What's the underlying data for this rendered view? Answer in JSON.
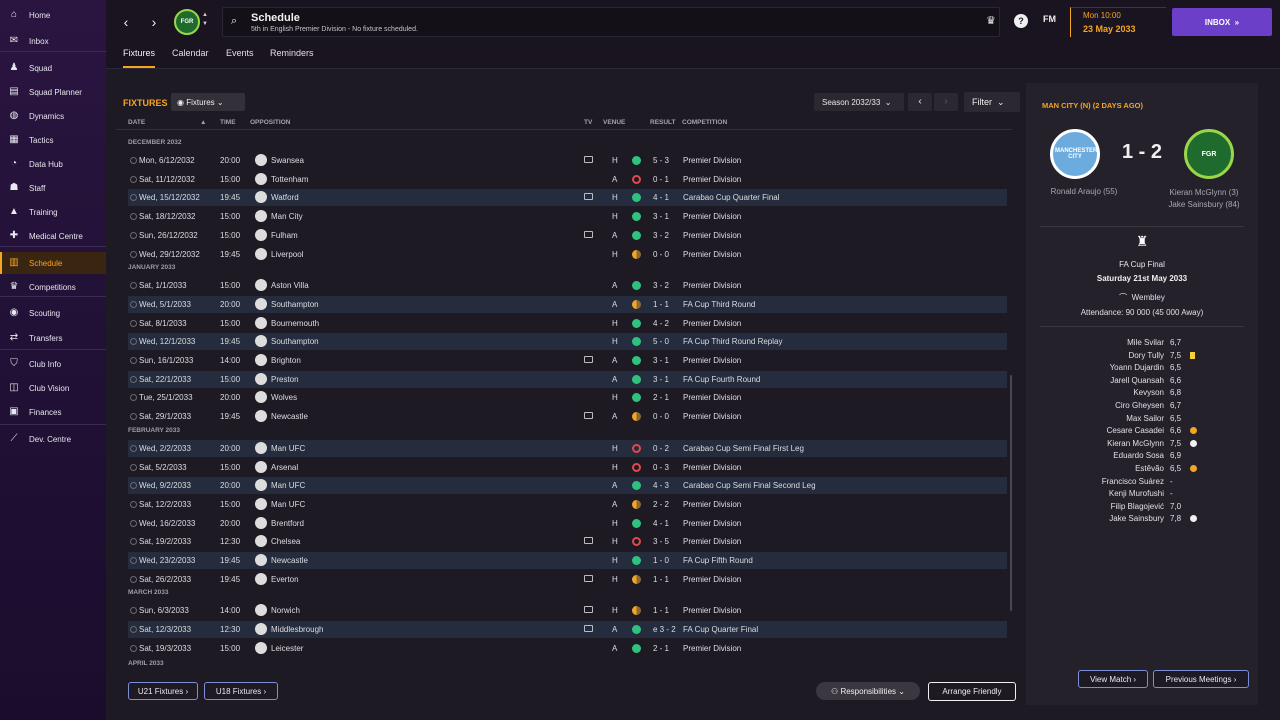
{
  "nav": [
    {
      "label": "Home",
      "icon": "home-icon",
      "glyph": "⌂"
    },
    {
      "label": "Inbox",
      "icon": "inbox-icon",
      "glyph": "✉"
    },
    {
      "label": "Squad",
      "icon": "shirt-icon",
      "glyph": "♟"
    },
    {
      "label": "Squad Planner",
      "icon": "planner-icon",
      "glyph": "▤"
    },
    {
      "label": "Dynamics",
      "icon": "dynamics-icon",
      "glyph": "◍"
    },
    {
      "label": "Tactics",
      "icon": "tactics-icon",
      "glyph": "▦"
    },
    {
      "label": "Data Hub",
      "icon": "data-hub-icon",
      "glyph": "◔"
    },
    {
      "label": "Staff",
      "icon": "staff-icon",
      "glyph": "☗"
    },
    {
      "label": "Training",
      "icon": "training-icon",
      "glyph": "▲"
    },
    {
      "label": "Medical Centre",
      "icon": "medical-icon",
      "glyph": "✚"
    },
    {
      "label": "Schedule",
      "icon": "calendar-icon",
      "glyph": "▥"
    },
    {
      "label": "Competitions",
      "icon": "trophy-icon",
      "glyph": "♛"
    },
    {
      "label": "Scouting",
      "icon": "scouting-icon",
      "glyph": "◉"
    },
    {
      "label": "Transfers",
      "icon": "transfers-icon",
      "glyph": "⇄"
    },
    {
      "label": "Club Info",
      "icon": "shield-icon",
      "glyph": "⛉"
    },
    {
      "label": "Club Vision",
      "icon": "vision-icon",
      "glyph": "◫"
    },
    {
      "label": "Finances",
      "icon": "finances-icon",
      "glyph": "▣"
    },
    {
      "label": "Dev. Centre",
      "icon": "dev-centre-icon",
      "glyph": "⟋"
    }
  ],
  "header": {
    "title": "Schedule",
    "subtitle": "5th in English Premier Division - No fixture scheduled.",
    "fm": "FM",
    "date_day": "Mon 10:00",
    "date_full": "23 May 2033",
    "inbox": "INBOX"
  },
  "tabs": [
    "Fixtures",
    "Calendar",
    "Events",
    "Reminders"
  ],
  "fixtures": {
    "title": "FIXTURES",
    "view_dropdown": "Fixtures",
    "season": "Season 2032/33",
    "filter": "Filter",
    "columns": {
      "date": "DATE",
      "time": "TIME",
      "opposition": "OPPOSITION",
      "tv": "TV",
      "venue": "VENUE",
      "result": "RESULT",
      "competition": "COMPETITION"
    },
    "months": [
      "DECEMBER 2032",
      "JANUARY 2033",
      "FEBRUARY 2033",
      "MARCH 2033",
      "APRIL 2033"
    ],
    "rows": [
      {
        "date": "Mon, 6/12/2032",
        "time": "20:00",
        "opp": "Swansea",
        "tv": true,
        "venue": "H",
        "res": "win",
        "score": "5 - 3",
        "comp": "Premier Division",
        "hl": false
      },
      {
        "date": "Sat, 11/12/2032",
        "time": "15:00",
        "opp": "Tottenham",
        "tv": false,
        "venue": "A",
        "res": "loss",
        "score": "0 - 1",
        "comp": "Premier Division",
        "hl": false
      },
      {
        "date": "Wed, 15/12/2032",
        "time": "19:45",
        "opp": "Watford",
        "tv": true,
        "venue": "H",
        "res": "win",
        "score": "4 - 1",
        "comp": "Carabao Cup Quarter Final",
        "hl": true
      },
      {
        "date": "Sat, 18/12/2032",
        "time": "15:00",
        "opp": "Man City",
        "tv": false,
        "venue": "H",
        "res": "win",
        "score": "3 - 1",
        "comp": "Premier Division",
        "hl": false
      },
      {
        "date": "Sun, 26/12/2032",
        "time": "15:00",
        "opp": "Fulham",
        "tv": true,
        "venue": "A",
        "res": "win",
        "score": "3 - 2",
        "comp": "Premier Division",
        "hl": false
      },
      {
        "date": "Wed, 29/12/2032",
        "time": "19:45",
        "opp": "Liverpool",
        "tv": false,
        "venue": "H",
        "res": "draw",
        "score": "0 - 0",
        "comp": "Premier Division",
        "hl": false
      },
      {
        "date": "Sat, 1/1/2033",
        "time": "15:00",
        "opp": "Aston Villa",
        "tv": false,
        "venue": "A",
        "res": "win",
        "score": "3 - 2",
        "comp": "Premier Division",
        "hl": false
      },
      {
        "date": "Wed, 5/1/2033",
        "time": "20:00",
        "opp": "Southampton",
        "tv": false,
        "venue": "A",
        "res": "draw",
        "score": "1 - 1",
        "comp": "FA Cup Third Round",
        "hl": true
      },
      {
        "date": "Sat, 8/1/2033",
        "time": "15:00",
        "opp": "Bournemouth",
        "tv": false,
        "venue": "H",
        "res": "win",
        "score": "4 - 2",
        "comp": "Premier Division",
        "hl": false
      },
      {
        "date": "Wed, 12/1/2033",
        "time": "19:45",
        "opp": "Southampton",
        "tv": false,
        "venue": "H",
        "res": "win",
        "score": "5 - 0",
        "comp": "FA Cup Third Round Replay",
        "hl": true
      },
      {
        "date": "Sun, 16/1/2033",
        "time": "14:00",
        "opp": "Brighton",
        "tv": true,
        "venue": "A",
        "res": "win",
        "score": "3 - 1",
        "comp": "Premier Division",
        "hl": false
      },
      {
        "date": "Sat, 22/1/2033",
        "time": "15:00",
        "opp": "Preston",
        "tv": false,
        "venue": "A",
        "res": "win",
        "score": "3 - 1",
        "comp": "FA Cup Fourth Round",
        "hl": true
      },
      {
        "date": "Tue, 25/1/2033",
        "time": "20:00",
        "opp": "Wolves",
        "tv": false,
        "venue": "H",
        "res": "win",
        "score": "2 - 1",
        "comp": "Premier Division",
        "hl": false
      },
      {
        "date": "Sat, 29/1/2033",
        "time": "19:45",
        "opp": "Newcastle",
        "tv": true,
        "venue": "A",
        "res": "draw",
        "score": "0 - 0",
        "comp": "Premier Division",
        "hl": false
      },
      {
        "date": "Wed, 2/2/2033",
        "time": "20:00",
        "opp": "Man UFC",
        "tv": false,
        "venue": "H",
        "res": "loss",
        "score": "0 - 2",
        "comp": "Carabao Cup Semi Final First Leg",
        "hl": true
      },
      {
        "date": "Sat, 5/2/2033",
        "time": "15:00",
        "opp": "Arsenal",
        "tv": false,
        "venue": "H",
        "res": "loss",
        "score": "0 - 3",
        "comp": "Premier Division",
        "hl": false
      },
      {
        "date": "Wed, 9/2/2033",
        "time": "20:00",
        "opp": "Man UFC",
        "tv": false,
        "venue": "A",
        "res": "win",
        "score": "4 - 3",
        "comp": "Carabao Cup Semi Final Second Leg",
        "hl": true
      },
      {
        "date": "Sat, 12/2/2033",
        "time": "15:00",
        "opp": "Man UFC",
        "tv": false,
        "venue": "A",
        "res": "draw",
        "score": "2 - 2",
        "comp": "Premier Division",
        "hl": false
      },
      {
        "date": "Wed, 16/2/2033",
        "time": "20:00",
        "opp": "Brentford",
        "tv": false,
        "venue": "H",
        "res": "win",
        "score": "4 - 1",
        "comp": "Premier Division",
        "hl": false
      },
      {
        "date": "Sat, 19/2/2033",
        "time": "12:30",
        "opp": "Chelsea",
        "tv": true,
        "venue": "H",
        "res": "loss",
        "score": "3 - 5",
        "comp": "Premier Division",
        "hl": false
      },
      {
        "date": "Wed, 23/2/2033",
        "time": "19:45",
        "opp": "Newcastle",
        "tv": false,
        "venue": "H",
        "res": "win",
        "score": "1 - 0",
        "comp": "FA Cup Fifth Round",
        "hl": true
      },
      {
        "date": "Sat, 26/2/2033",
        "time": "19:45",
        "opp": "Everton",
        "tv": true,
        "venue": "H",
        "res": "draw",
        "score": "1 - 1",
        "comp": "Premier Division",
        "hl": false
      },
      {
        "date": "Sun, 6/3/2033",
        "time": "14:00",
        "opp": "Norwich",
        "tv": true,
        "venue": "H",
        "res": "draw",
        "score": "1 - 1",
        "comp": "Premier Division",
        "hl": false
      },
      {
        "date": "Sat, 12/3/2033",
        "time": "12:30",
        "opp": "Middlesbrough",
        "tv": true,
        "venue": "A",
        "res": "win",
        "score": "e 3 - 2",
        "comp": "FA Cup Quarter Final",
        "hl": true
      },
      {
        "date": "Sat, 19/3/2033",
        "time": "15:00",
        "opp": "Leicester",
        "tv": false,
        "venue": "A",
        "res": "win",
        "score": "2 - 1",
        "comp": "Premier Division",
        "hl": false
      }
    ],
    "u21": "U21 Fixtures",
    "u18": "U18 Fixtures",
    "responsibilities": "Responsibilities",
    "arrange": "Arrange Friendly"
  },
  "match": {
    "header": "MAN CITY (N) (2 DAYS AGO)",
    "home_crest_text": "MANCHESTER CITY",
    "away_crest_text": "FGR",
    "score": "1 - 2",
    "home_scorers": "Ronald Araujo (55)",
    "away_scorer_1": "Kieran McGlynn (3)",
    "away_scorer_2": "Jake Sainsbury (84)",
    "competition": "FA Cup Final",
    "date": "Saturday 21st May 2033",
    "venue": "Wembley",
    "attendance": "Attendance: 90 000 (45 000 Away)",
    "players": [
      {
        "name": "Mile Svilar",
        "rating": "6,7",
        "icon": ""
      },
      {
        "name": "Dory Tully",
        "rating": "7,5",
        "icon": "card"
      },
      {
        "name": "Yoann Dujardin",
        "rating": "6,5",
        "icon": ""
      },
      {
        "name": "Jarell Quansah",
        "rating": "6,6",
        "icon": ""
      },
      {
        "name": "Kevyson",
        "rating": "6,8",
        "icon": ""
      },
      {
        "name": "Ciro Gheysen",
        "rating": "6,7",
        "icon": ""
      },
      {
        "name": "Max Sailor",
        "rating": "6,5",
        "icon": ""
      },
      {
        "name": "Cesare Casadei",
        "rating": "6,6",
        "icon": "sub"
      },
      {
        "name": "Kieran McGlynn",
        "rating": "7,5",
        "icon": "goal"
      },
      {
        "name": "Eduardo Sosa",
        "rating": "6,9",
        "icon": ""
      },
      {
        "name": "Estêvão",
        "rating": "6,5",
        "icon": "sub"
      },
      {
        "name": "Francisco Suárez",
        "rating": "-",
        "icon": ""
      },
      {
        "name": "Kenji Murofushi",
        "rating": "-",
        "icon": ""
      },
      {
        "name": "Filip Blagojević",
        "rating": "7,0",
        "icon": ""
      },
      {
        "name": "Jake Sainsbury",
        "rating": "7,8",
        "icon": "goal"
      }
    ],
    "view_match": "View Match",
    "previous_meetings": "Previous Meetings"
  },
  "colors": {
    "accent": "#f5a524",
    "inbox": "#6b3fc8",
    "win": "#2ec27e",
    "loss": "#e04a4a",
    "highlight_row": "#242c3d"
  }
}
